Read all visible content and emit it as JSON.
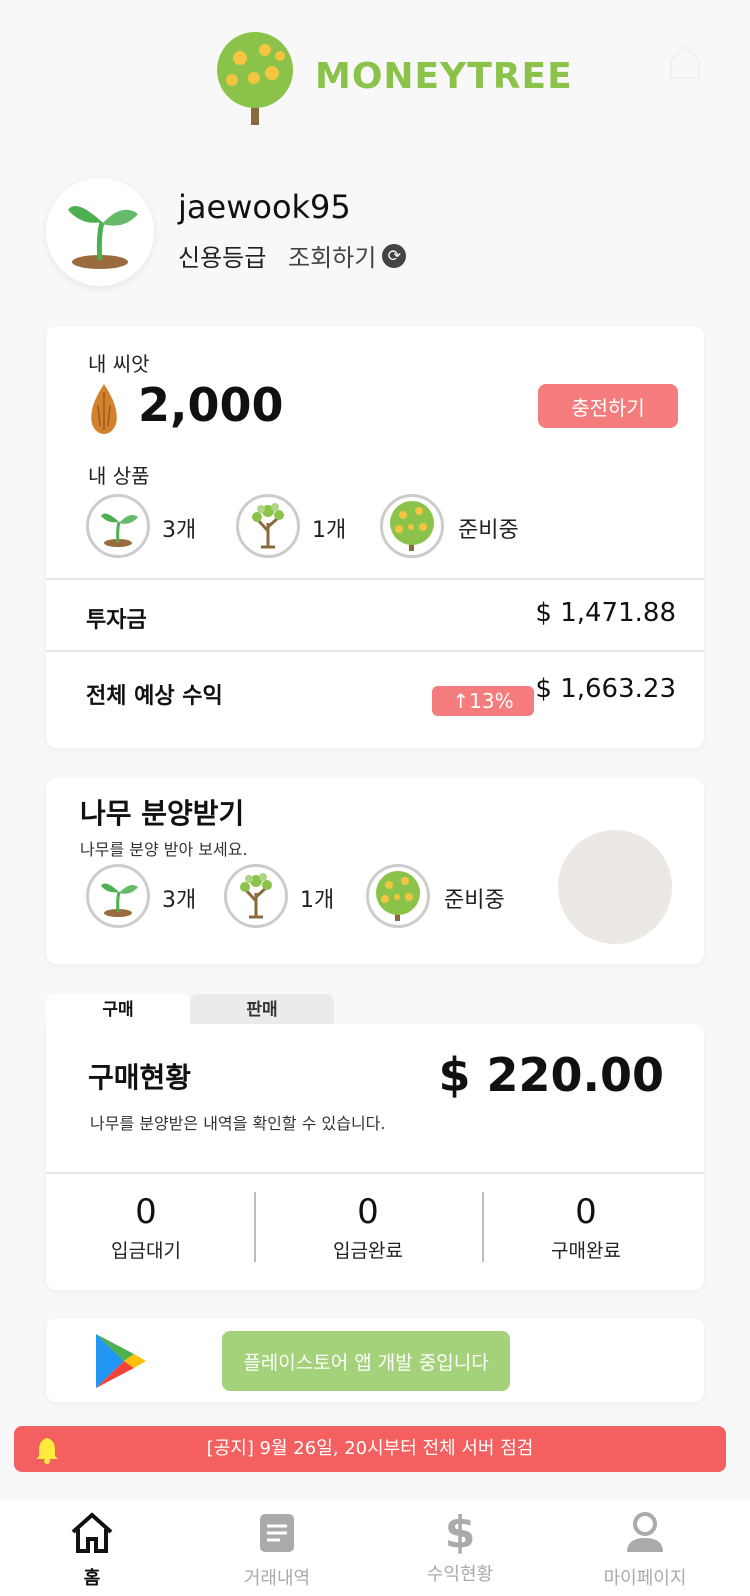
{
  "header": {
    "brand": "MONEYTREE"
  },
  "profile": {
    "username": "jaewook95",
    "credit_label": "신용등급",
    "lookup_label": "조회하기"
  },
  "seed_card": {
    "seed_label": "내 씨앗",
    "seed_amount": "2,000",
    "charge_label": "충전하기",
    "products_label": "내 상품",
    "products": [
      {
        "icon": "sprout-icon",
        "text": "3개"
      },
      {
        "icon": "young-tree-icon",
        "text": "1개"
      },
      {
        "icon": "money-tree-icon",
        "text": "준비중"
      }
    ],
    "investment_label": "투자금",
    "investment_value": "$ 1,471.88",
    "expected_label": "전체 예상 수익",
    "expected_change": "↑13%",
    "expected_value": "$ 1,663.23"
  },
  "tree_card": {
    "title": "나무 분양받기",
    "subtitle": "나무를 분양 받아 보세요.",
    "products": [
      {
        "icon": "sprout-icon",
        "text": "3개"
      },
      {
        "icon": "young-tree-icon",
        "text": "1개"
      },
      {
        "icon": "money-tree-icon",
        "text": "준비중"
      }
    ]
  },
  "tabs": {
    "buy": "구매",
    "sell": "판매"
  },
  "purchase": {
    "title": "구매현황",
    "amount": "$ 220.00",
    "subtitle": "나무를 분양받은 내역을 확인할 수 있습니다.",
    "stats": [
      {
        "value": "0",
        "label": "입금대기"
      },
      {
        "value": "0",
        "label": "입금완료"
      },
      {
        "value": "0",
        "label": "구매완료"
      }
    ]
  },
  "playstore": {
    "button_label": "플레이스토어 앱 개발 중입니다"
  },
  "notice": {
    "text": "[공지] 9월 26일, 20시부터 전체 서버 점검"
  },
  "nav": [
    {
      "label": "홈",
      "icon": "home-icon",
      "active": true
    },
    {
      "label": "거래내역",
      "icon": "document-icon"
    },
    {
      "label": "수익현황",
      "icon": "dollar-icon"
    },
    {
      "label": "마이페이지",
      "icon": "user-icon"
    }
  ],
  "colors": {
    "brand_green": "#8bc34a",
    "accent_red": "#f57c7c",
    "notice_red": "#f45f5f",
    "button_green": "#a4d27a"
  }
}
